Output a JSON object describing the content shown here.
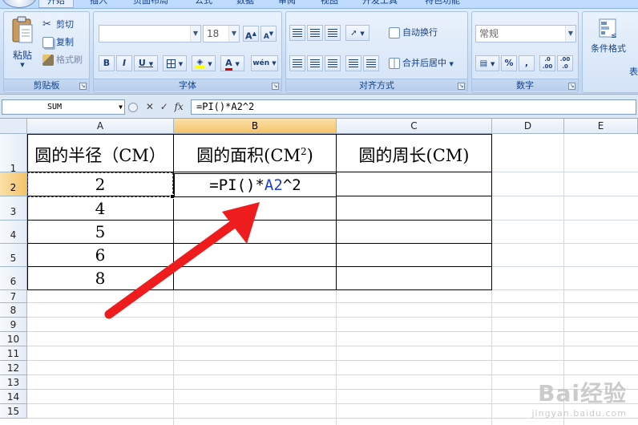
{
  "ribbon": {
    "tabs": [
      "开始",
      "插入",
      "页面布局",
      "公式",
      "数据",
      "审阅",
      "视图",
      "开发工具",
      "特色功能"
    ],
    "active_tab": "开始",
    "clipboard": {
      "label": "剪贴板",
      "paste": "粘贴",
      "cut": "剪切",
      "copy": "复制",
      "format_painter": "格式刷"
    },
    "font": {
      "label": "字体",
      "font_size": "18",
      "grow_label": "A",
      "shrink_label": "A",
      "bold": "B",
      "italic": "I",
      "underline": "U",
      "font_color": "A",
      "phonetic": "wén"
    },
    "alignment": {
      "label": "对齐方式",
      "wrap_text": "自动换行",
      "merge_center": "合并后居中"
    },
    "number": {
      "label": "数字",
      "format": "常规",
      "percent": "%",
      "comma": ",",
      "inc_decimal": ".0 .00",
      "dec_decimal": ".00 .0"
    },
    "styles": {
      "conditional": "条件格式",
      "table_partial": "表"
    }
  },
  "formula_bar": {
    "name_box": "SUM",
    "cancel": "✕",
    "enter": "✓",
    "fx": "fx",
    "formula": "=PI()*A2^2"
  },
  "columns": [
    "A",
    "B",
    "C",
    "D",
    "E"
  ],
  "rows": [
    "1",
    "2",
    "3",
    "4",
    "5",
    "6",
    "7",
    "8",
    "9",
    "10",
    "11",
    "12",
    "13",
    "14",
    "15"
  ],
  "table": {
    "header_a": "圆的半径（CM）",
    "header_b": "圆的面积(CM",
    "header_b_sup": "2",
    "header_b_close": ")",
    "header_c": "圆的周长(CM)",
    "radii": [
      "2",
      "4",
      "5",
      "6",
      "8"
    ]
  },
  "editing_cell": {
    "prefix": "=PI()*",
    "ref": "A2",
    "suffix": "^2"
  },
  "watermark": {
    "brand": "Bai经验",
    "url": "jingyan.baidu.com"
  },
  "colors": {
    "arrow": "#ee1c1c",
    "ref_blue": "#1f3ec9",
    "selected_header": "#f5c46a"
  }
}
